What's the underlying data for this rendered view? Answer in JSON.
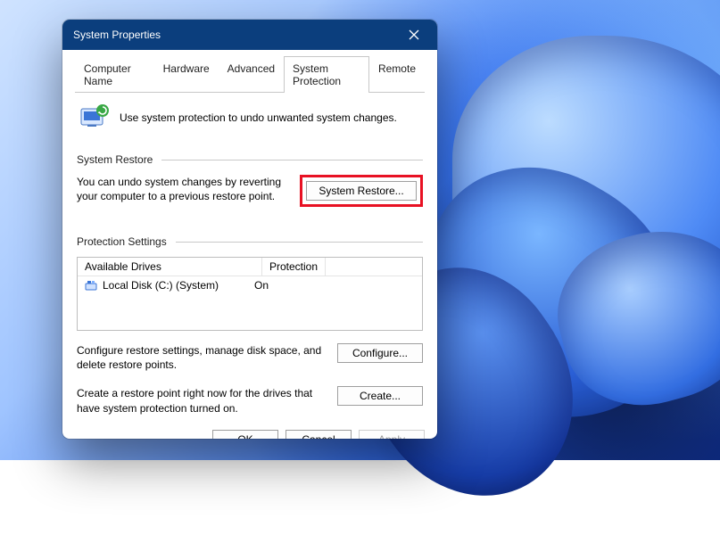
{
  "window": {
    "title": "System Properties"
  },
  "tabs": {
    "t0": "Computer Name",
    "t1": "Hardware",
    "t2": "Advanced",
    "t3": "System Protection",
    "t4": "Remote"
  },
  "info": {
    "text": "Use system protection to undo unwanted system changes."
  },
  "restore": {
    "title": "System Restore",
    "desc": "You can undo system changes by reverting your computer to a previous restore point.",
    "button": "System Restore..."
  },
  "protection": {
    "title": "Protection Settings",
    "col_drives": "Available Drives",
    "col_protection": "Protection",
    "drive_name": "Local Disk (C:) (System)",
    "drive_status": "On",
    "configure_desc": "Configure restore settings, manage disk space, and delete restore points.",
    "configure_btn": "Configure...",
    "create_desc": "Create a restore point right now for the drives that have system protection turned on.",
    "create_btn": "Create..."
  },
  "footer": {
    "ok": "OK",
    "cancel": "Cancel",
    "apply": "Apply"
  }
}
